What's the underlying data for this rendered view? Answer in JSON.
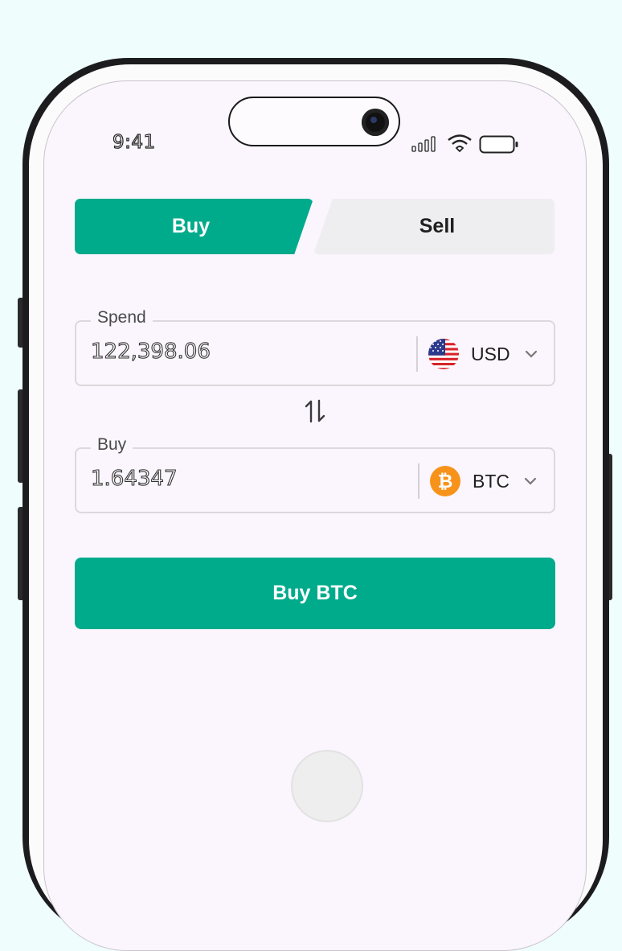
{
  "status_bar": {
    "time": "9:41"
  },
  "trade_tabs": {
    "buy_label": "Buy",
    "sell_label": "Sell",
    "active": "Buy"
  },
  "spend_field": {
    "label": "Spend",
    "value": "122,398.06",
    "currency": "USD",
    "currency_icon": "us-flag-icon"
  },
  "buy_field": {
    "label": "Buy",
    "value": "1.64347",
    "currency": "BTC",
    "currency_icon": "bitcoin-icon"
  },
  "swap": {
    "icon": "swap-arrows-icon"
  },
  "primary_action": {
    "label": "Buy BTC"
  },
  "colors": {
    "accent": "#00ab8c",
    "inactive_tab": "#eeedef",
    "background": "#fbf5fd",
    "bitcoin": "#f7931a"
  }
}
